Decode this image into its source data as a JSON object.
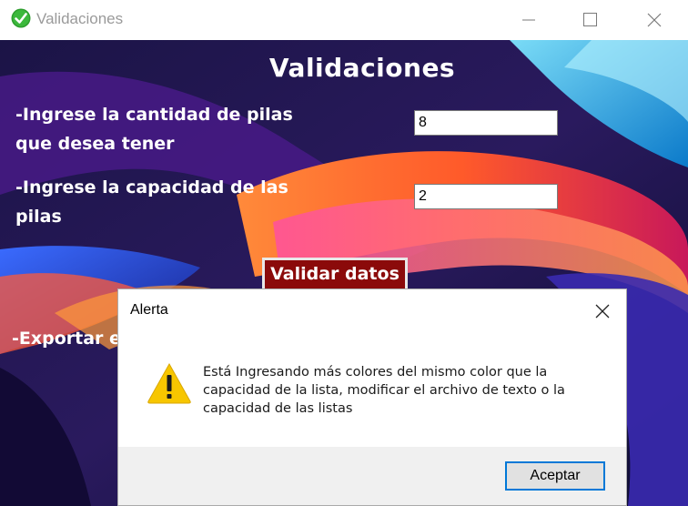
{
  "window": {
    "title": "Validaciones",
    "icon": "green-checkmark-icon"
  },
  "form": {
    "heading": "Validaciones",
    "quantity_prompt": "-Ingrese la cantidad de pilas que desea tener",
    "quantity_value": "8",
    "capacity_prompt": "-Ingrese la capacidad de las pilas",
    "capacity_value": "2",
    "validate_label": "Validar datos",
    "export_prompt": "-Exportar e"
  },
  "alert": {
    "title": "Alerta",
    "icon": "warning-icon",
    "message": "Está Ingresando más colores del mismo color que la capacidad de la lista, modificar el archivo de texto o la capacidad de las listas",
    "ok_label": "Aceptar"
  },
  "colors": {
    "validate_button_bg": "#8b0a0a",
    "ok_button_border": "#0078d7",
    "warning_yellow": "#f7c600"
  }
}
